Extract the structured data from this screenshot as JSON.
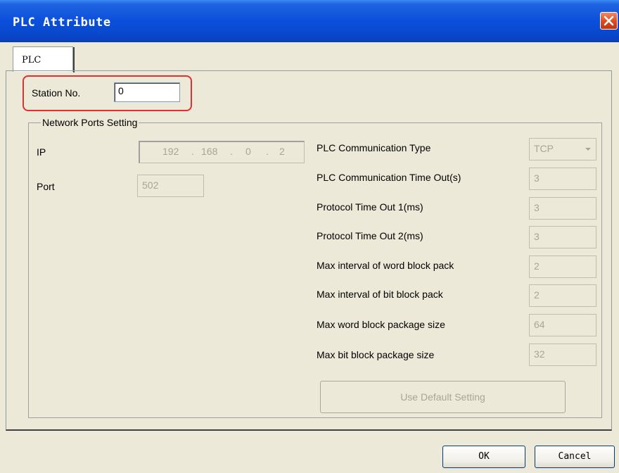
{
  "window": {
    "title": "PLC Attribute"
  },
  "tabs": [
    {
      "label": "PLC"
    }
  ],
  "station": {
    "label": "Station No.",
    "value": "0"
  },
  "network": {
    "legend": "Network Ports Setting",
    "ip_label": "IP",
    "ip_octets": [
      "192",
      "168",
      "0",
      "2"
    ],
    "ip_separator": ".",
    "port_label": "Port",
    "port_value": "502"
  },
  "settings": {
    "comm_type_label": "PLC Communication Type",
    "comm_type_value": "TCP",
    "rows": [
      {
        "label": "PLC Communication Time Out(s)",
        "value": "3"
      },
      {
        "label": "Protocol Time Out 1(ms)",
        "value": "3"
      },
      {
        "label": "Protocol Time Out 2(ms)",
        "value": "3"
      },
      {
        "label": "Max interval of word block pack",
        "value": "2"
      },
      {
        "label": "Max interval of bit block pack",
        "value": "2"
      },
      {
        "label": "Max word block package size",
        "value": "64"
      },
      {
        "label": "Max bit block package size",
        "value": "32"
      }
    ],
    "default_button": "Use Default Setting"
  },
  "footer": {
    "ok_label": "OK",
    "cancel_label": "Cancel"
  },
  "colors": {
    "titlebar": "#0a4fdb",
    "highlight": "#e03030",
    "dialog_bg": "#ece9d8",
    "close": "#dc4a1c"
  }
}
